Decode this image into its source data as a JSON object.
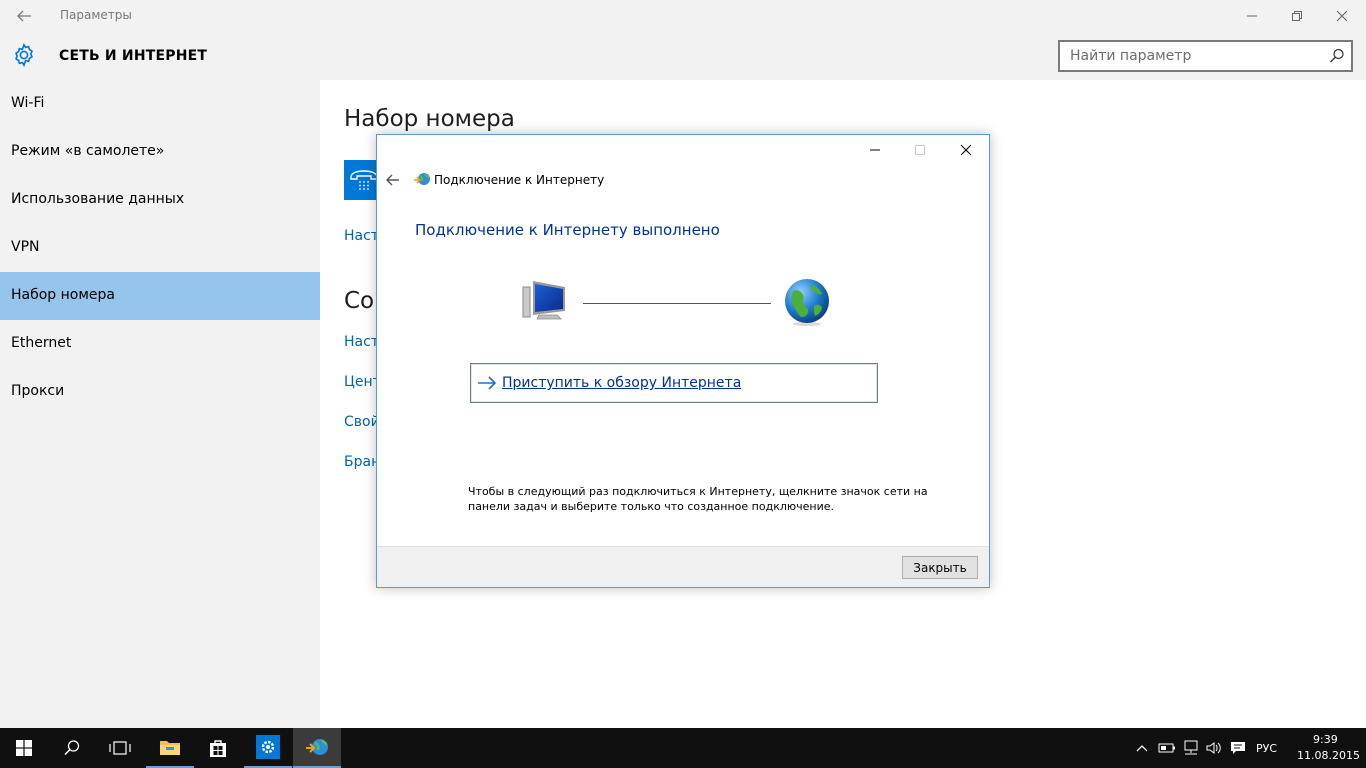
{
  "window": {
    "title": "Параметры"
  },
  "header": {
    "section_title": "СЕТЬ И ИНТЕРНЕТ",
    "search_placeholder": "Найти параметр"
  },
  "sidebar": {
    "items": [
      {
        "label": "Wi-Fi"
      },
      {
        "label": "Режим «в самолете»"
      },
      {
        "label": "Использование данных"
      },
      {
        "label": "VPN"
      },
      {
        "label": "Набор номера",
        "active": true
      },
      {
        "label": "Ethernet"
      },
      {
        "label": "Прокси"
      }
    ]
  },
  "content": {
    "heading": "Набор номера",
    "link_partial_1": "Наст",
    "heading_partial": "Соп",
    "links_partial": [
      "Наст",
      "Цент",
      "Свой",
      "Бран"
    ]
  },
  "dialog": {
    "title": "Подключение к Интернету",
    "heading": "Подключение к Интернету выполнено",
    "browse_label": "Приступить к обзору Интернета",
    "info_line1": "Чтобы в следующий раз подключиться к Интернету, щелкните значок сети на",
    "info_line2": "панели задач и выберите только что созданное подключение.",
    "close_button": "Закрыть"
  },
  "taskbar": {
    "language": "РУС",
    "time": "9:39",
    "date": "11.08.2015"
  },
  "colors": {
    "accent": "#0078d7",
    "sidebar_active": "#96c5ec",
    "link": "#0063b1",
    "dialog_heading": "#003399"
  }
}
